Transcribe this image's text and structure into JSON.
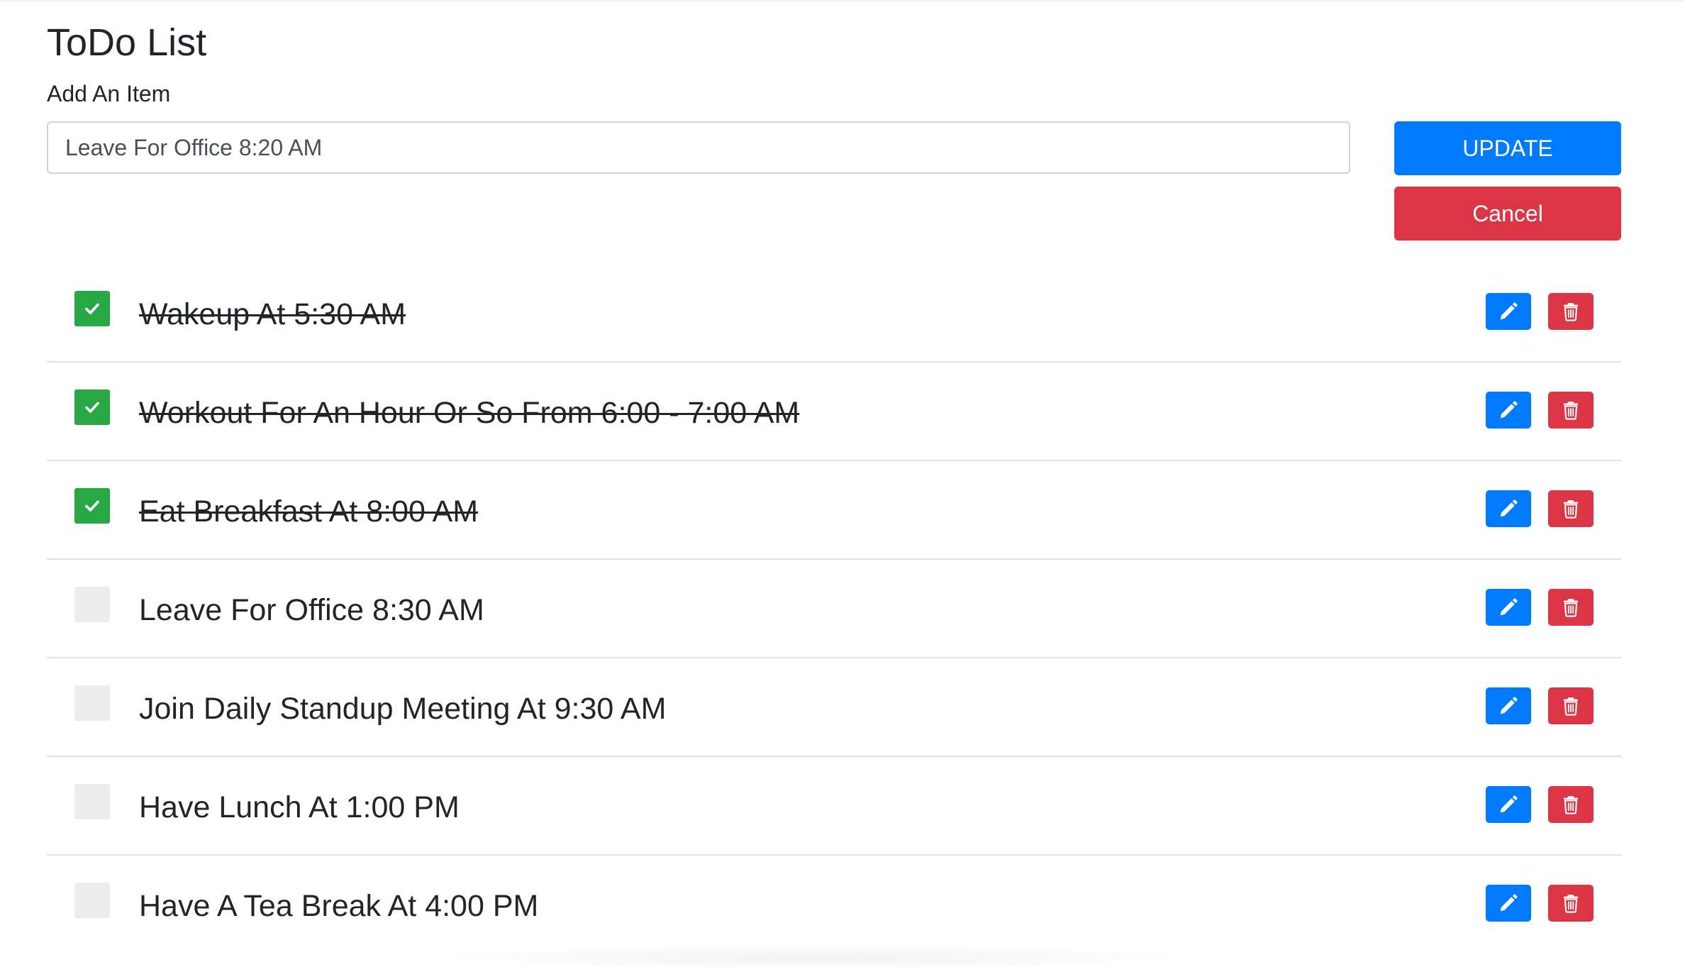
{
  "header": {
    "title": "ToDo List",
    "add_label": "Add An Item"
  },
  "form": {
    "input_value": "Leave For Office 8:20 AM",
    "update_label": "UPDATE",
    "cancel_label": "Cancel"
  },
  "colors": {
    "primary": "#007bff",
    "danger": "#dc3545",
    "success": "#28a745",
    "unchecked": "#ececec"
  },
  "icons": {
    "check": "check-icon",
    "edit": "pencil-icon",
    "delete": "trash-icon"
  },
  "todos": [
    {
      "text": "Wakeup At 5:30 AM",
      "done": true
    },
    {
      "text": "Workout For An Hour Or So From 6:00 - 7:00 AM",
      "done": true
    },
    {
      "text": "Eat Breakfast At 8:00 AM",
      "done": true
    },
    {
      "text": "Leave For Office 8:30 AM",
      "done": false
    },
    {
      "text": "Join Daily Standup Meeting At 9:30 AM",
      "done": false
    },
    {
      "text": "Have Lunch At 1:00 PM",
      "done": false
    },
    {
      "text": "Have A Tea Break At 4:00 PM",
      "done": false
    }
  ]
}
